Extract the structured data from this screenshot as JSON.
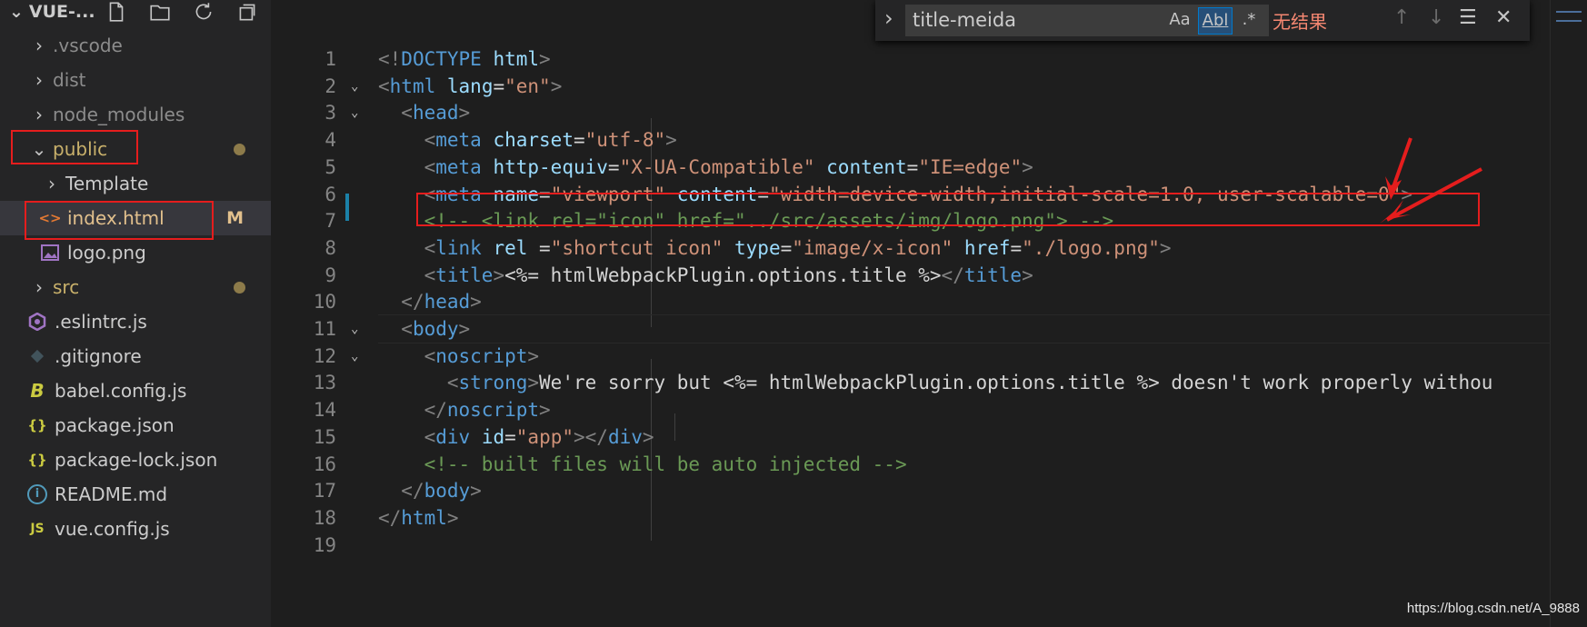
{
  "sidebar": {
    "title": "VUE-...",
    "items": [
      {
        "label": ".vscode",
        "type": "folder",
        "expanded": false
      },
      {
        "label": "dist",
        "type": "folder",
        "expanded": false
      },
      {
        "label": "node_modules",
        "type": "folder",
        "expanded": false
      },
      {
        "label": "public",
        "type": "folder",
        "expanded": true
      },
      {
        "label": "Template",
        "type": "folder",
        "expanded": false
      },
      {
        "label": "index.html",
        "type": "file",
        "badge": "M"
      },
      {
        "label": "logo.png",
        "type": "file"
      },
      {
        "label": "src",
        "type": "folder",
        "expanded": false
      },
      {
        "label": ".eslintrc.js",
        "type": "file"
      },
      {
        "label": ".gitignore",
        "type": "file"
      },
      {
        "label": "babel.config.js",
        "type": "file"
      },
      {
        "label": "package.json",
        "type": "file"
      },
      {
        "label": "package-lock.json",
        "type": "file"
      },
      {
        "label": "README.md",
        "type": "file"
      },
      {
        "label": "vue.config.js",
        "type": "file"
      }
    ],
    "icons": {
      "html": "<>",
      "json": "{}",
      "js": "JS",
      "babel": "B",
      "info": "i"
    }
  },
  "find": {
    "query": "title-meida",
    "match_case": "Aa",
    "whole_word": "Abl",
    "regex": ".*",
    "result": "无结果"
  },
  "editor": {
    "line_numbers": [
      "1",
      "2",
      "3",
      "4",
      "5",
      "6",
      "7",
      "8",
      "9",
      "10",
      "11",
      "12",
      "13",
      "14",
      "15",
      "16",
      "17",
      "18",
      "19"
    ],
    "lines": [
      {
        "tok": [
          [
            "p",
            "<!"
          ],
          [
            "t",
            "DOCTYPE"
          ],
          [
            "w",
            " "
          ],
          [
            "a",
            "html"
          ],
          [
            "p",
            ">"
          ]
        ]
      },
      {
        "tok": [
          [
            "p",
            "<"
          ],
          [
            "t",
            "html"
          ],
          [
            "w",
            " "
          ],
          [
            "a",
            "lang"
          ],
          [
            "w",
            "="
          ],
          [
            "s",
            "\"en\""
          ],
          [
            "p",
            ">"
          ]
        ]
      },
      {
        "tok": [
          [
            "w",
            "  "
          ],
          [
            "p",
            "<"
          ],
          [
            "t",
            "head"
          ],
          [
            "p",
            ">"
          ]
        ]
      },
      {
        "tok": [
          [
            "w",
            "    "
          ],
          [
            "p",
            "<"
          ],
          [
            "t",
            "meta"
          ],
          [
            "w",
            " "
          ],
          [
            "a",
            "charset"
          ],
          [
            "w",
            "="
          ],
          [
            "s",
            "\"utf-8\""
          ],
          [
            "p",
            ">"
          ]
        ]
      },
      {
        "tok": [
          [
            "w",
            "    "
          ],
          [
            "p",
            "<"
          ],
          [
            "t",
            "meta"
          ],
          [
            "w",
            " "
          ],
          [
            "a",
            "http-equiv"
          ],
          [
            "w",
            "="
          ],
          [
            "s",
            "\"X-UA-Compatible\""
          ],
          [
            "w",
            " "
          ],
          [
            "a",
            "content"
          ],
          [
            "w",
            "="
          ],
          [
            "s",
            "\"IE=edge\""
          ],
          [
            "p",
            ">"
          ]
        ]
      },
      {
        "tok": [
          [
            "w",
            "    "
          ],
          [
            "p",
            "<"
          ],
          [
            "t",
            "meta"
          ],
          [
            "w",
            " "
          ],
          [
            "a",
            "name"
          ],
          [
            "w",
            "="
          ],
          [
            "s",
            "\"viewport\""
          ],
          [
            "w",
            " "
          ],
          [
            "a",
            "content"
          ],
          [
            "w",
            "="
          ],
          [
            "s",
            "\"width=device-width,initial-scale=1.0, user-scalable=0\""
          ],
          [
            "p",
            ">"
          ]
        ]
      },
      {
        "tok": [
          [
            "w",
            "    "
          ],
          [
            "c",
            "<!-- <link rel=\"icon\" href=\"../src/assets/img/logo.png\"> -->"
          ]
        ]
      },
      {
        "tok": [
          [
            "w",
            "    "
          ],
          [
            "p",
            "<"
          ],
          [
            "t",
            "link"
          ],
          [
            "w",
            " "
          ],
          [
            "a",
            "rel"
          ],
          [
            "w",
            " ="
          ],
          [
            "s",
            "\"shortcut icon\""
          ],
          [
            "w",
            " "
          ],
          [
            "a",
            "type"
          ],
          [
            "w",
            "="
          ],
          [
            "s",
            "\"image/x-icon\""
          ],
          [
            "w",
            " "
          ],
          [
            "a",
            "href"
          ],
          [
            "w",
            "="
          ],
          [
            "s",
            "\"./logo.png\""
          ],
          [
            "p",
            ">"
          ]
        ]
      },
      {
        "tok": [
          [
            "w",
            "    "
          ],
          [
            "p",
            "<"
          ],
          [
            "t",
            "title"
          ],
          [
            "p",
            ">"
          ],
          [
            "w",
            "<%= htmlWebpackPlugin.options.title %>"
          ],
          [
            "p",
            "</"
          ],
          [
            "t",
            "title"
          ],
          [
            "p",
            ">"
          ]
        ]
      },
      {
        "tok": [
          [
            "w",
            "  "
          ],
          [
            "p",
            "</"
          ],
          [
            "t",
            "head"
          ],
          [
            "p",
            ">"
          ]
        ]
      },
      {
        "tok": [
          [
            "w",
            "  "
          ],
          [
            "p",
            "<"
          ],
          [
            "t",
            "body"
          ],
          [
            "p",
            ">"
          ]
        ]
      },
      {
        "tok": [
          [
            "w",
            "    "
          ],
          [
            "p",
            "<"
          ],
          [
            "t",
            "noscript"
          ],
          [
            "p",
            ">"
          ]
        ]
      },
      {
        "tok": [
          [
            "w",
            "      "
          ],
          [
            "p",
            "<"
          ],
          [
            "t",
            "strong"
          ],
          [
            "p",
            ">"
          ],
          [
            "w",
            "We're sorry but <%= htmlWebpackPlugin.options.title %> doesn't work properly withou"
          ]
        ]
      },
      {
        "tok": [
          [
            "w",
            "    "
          ],
          [
            "p",
            "</"
          ],
          [
            "t",
            "noscript"
          ],
          [
            "p",
            ">"
          ]
        ]
      },
      {
        "tok": [
          [
            "w",
            "    "
          ],
          [
            "p",
            "<"
          ],
          [
            "t",
            "div"
          ],
          [
            "w",
            " "
          ],
          [
            "a",
            "id"
          ],
          [
            "w",
            "="
          ],
          [
            "s",
            "\"app\""
          ],
          [
            "p",
            "></"
          ],
          [
            "t",
            "div"
          ],
          [
            "p",
            ">"
          ]
        ]
      },
      {
        "tok": [
          [
            "w",
            "    "
          ],
          [
            "c",
            "<!-- built files will be auto injected -->"
          ]
        ]
      },
      {
        "tok": [
          [
            "w",
            "  "
          ],
          [
            "p",
            "</"
          ],
          [
            "t",
            "body"
          ],
          [
            "p",
            ">"
          ]
        ]
      },
      {
        "tok": [
          [
            "p",
            "</"
          ],
          [
            "t",
            "html"
          ],
          [
            "p",
            ">"
          ]
        ]
      },
      {
        "tok": []
      }
    ]
  },
  "watermark": "https://blog.csdn.net/A_9888",
  "colors": {
    "annotation_red": "#e51d1d",
    "modified_badge": "#e2c08d",
    "folder_modified": "#c9b16b"
  }
}
